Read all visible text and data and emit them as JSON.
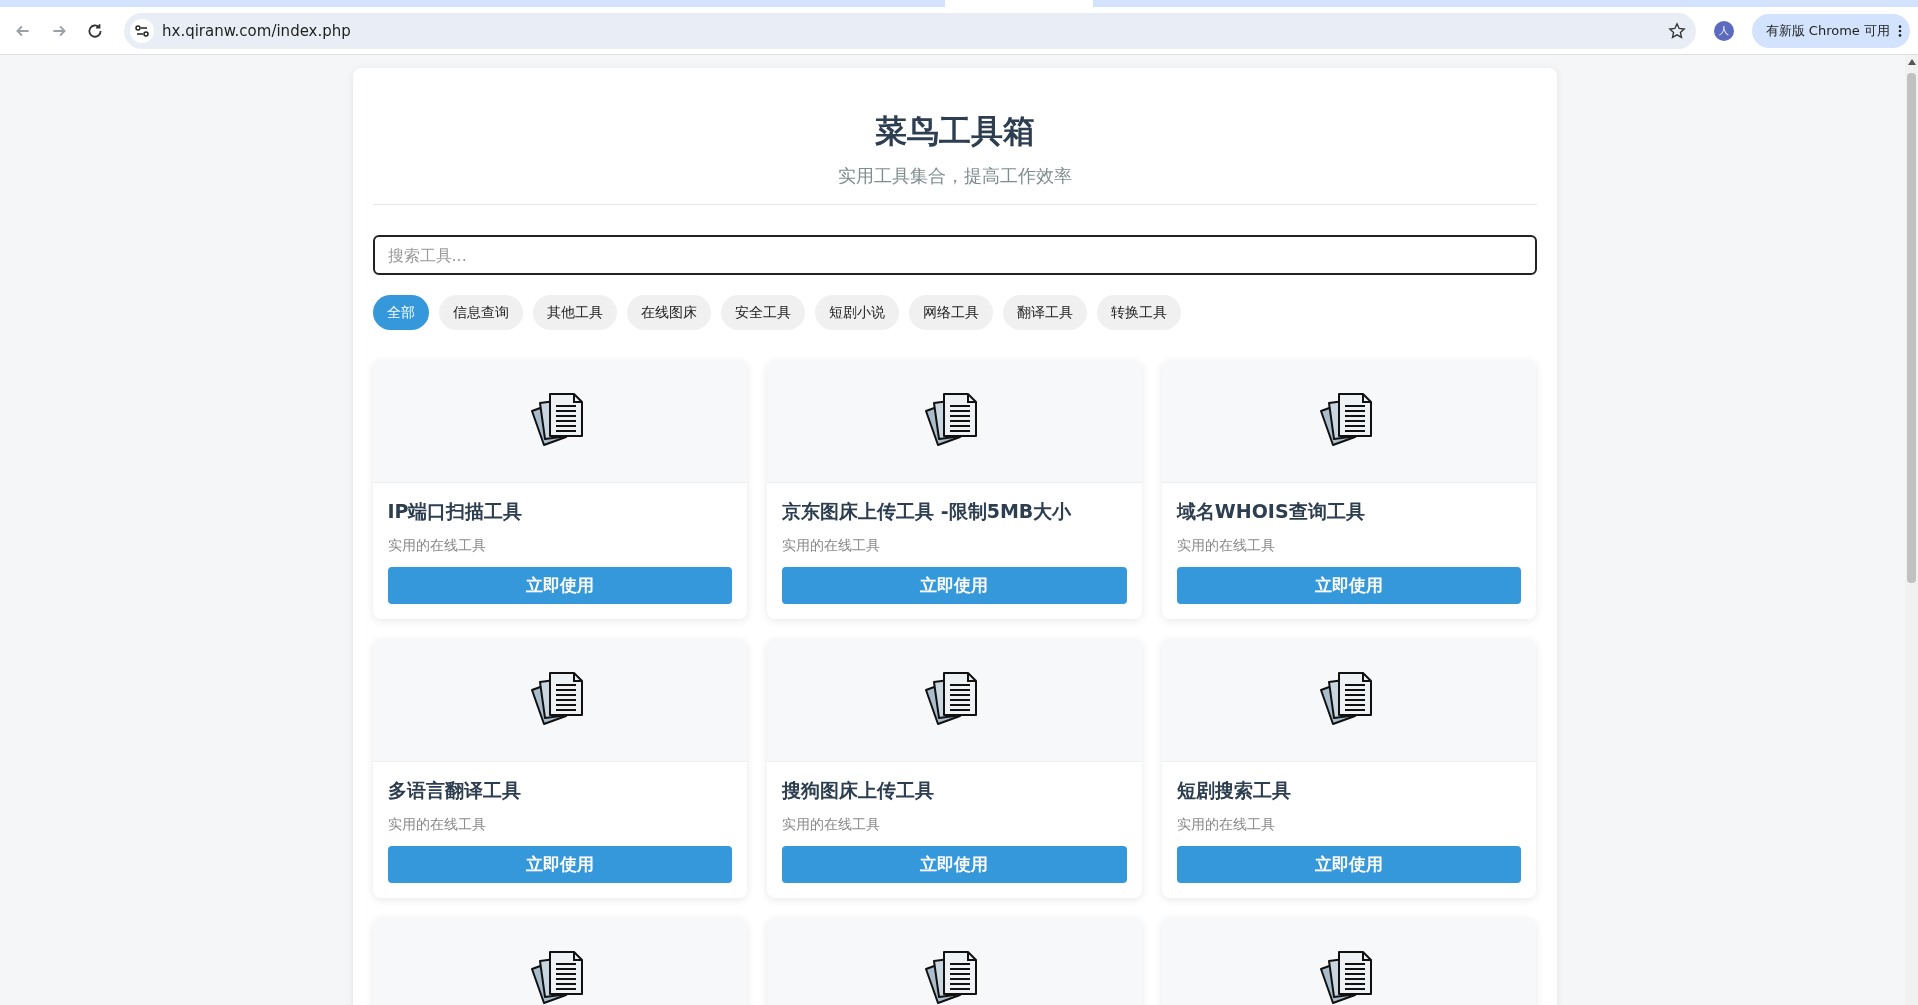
{
  "browser": {
    "url": "hx.qiranw.com/index.php",
    "profile_initial": "人",
    "update_button": "有新版 Chrome 可用"
  },
  "header": {
    "title": "菜鸟工具箱",
    "subtitle": "实用工具集合，提高工作效率"
  },
  "search": {
    "placeholder": "搜索工具..."
  },
  "categories": [
    {
      "label": "全部",
      "selected": true
    },
    {
      "label": "信息查询",
      "selected": false
    },
    {
      "label": "其他工具",
      "selected": false
    },
    {
      "label": "在线图床",
      "selected": false
    },
    {
      "label": "安全工具",
      "selected": false
    },
    {
      "label": "短剧小说",
      "selected": false
    },
    {
      "label": "网络工具",
      "selected": false
    },
    {
      "label": "翻译工具",
      "selected": false
    },
    {
      "label": "转换工具",
      "selected": false
    }
  ],
  "tools": [
    {
      "kind": "full",
      "title": "IP端口扫描工具",
      "description": "实用的在线工具",
      "button": "立即使用"
    },
    {
      "kind": "full",
      "title": "京东图床上传工具 -限制5MB大小",
      "description": "实用的在线工具",
      "button": "立即使用"
    },
    {
      "kind": "full",
      "title": "域名WHOIS查询工具",
      "description": "实用的在线工具",
      "button": "立即使用"
    },
    {
      "kind": "full",
      "title": "多语言翻译工具",
      "description": "实用的在线工具",
      "button": "立即使用"
    },
    {
      "kind": "full",
      "title": "搜狗图床上传工具",
      "description": "实用的在线工具",
      "button": "立即使用"
    },
    {
      "kind": "full",
      "title": "短剧搜索工具",
      "description": "实用的在线工具",
      "button": "立即使用"
    },
    {
      "kind": "cut_off"
    },
    {
      "kind": "cut_off"
    },
    {
      "kind": "cut_off"
    }
  ]
}
